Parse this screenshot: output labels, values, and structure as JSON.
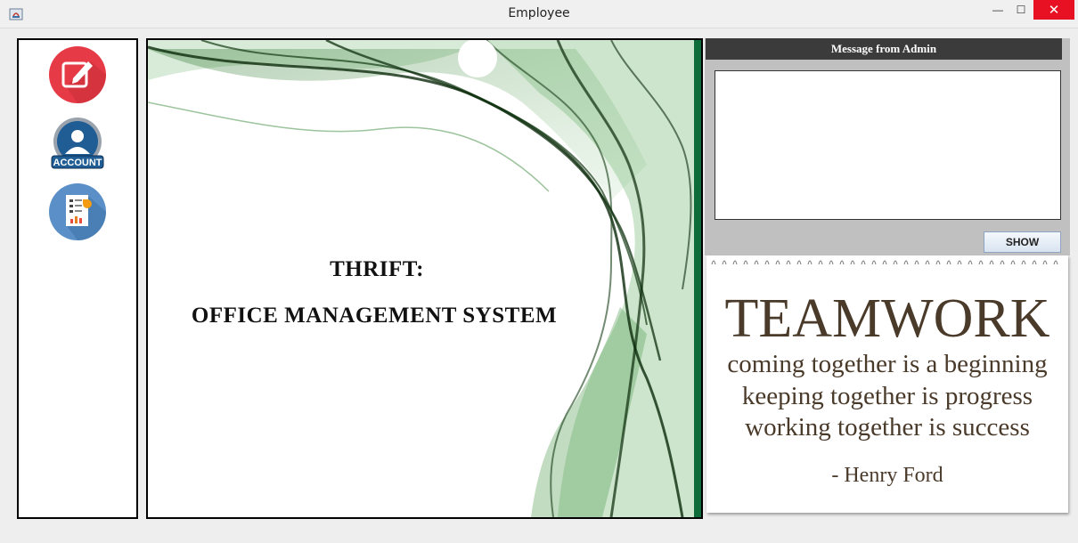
{
  "window": {
    "title": "Employee",
    "minimize_glyph": "—",
    "maximize_glyph": "☐",
    "close_glyph": "✕"
  },
  "sidebar": {
    "items": [
      {
        "name": "edit",
        "icon": "edit-icon",
        "color": "#e63a46"
      },
      {
        "name": "account",
        "icon": "account-icon",
        "label": "ACCOUNT",
        "color": "#2b6aa0"
      },
      {
        "name": "report",
        "icon": "report-icon",
        "color": "#5a8fc7"
      }
    ]
  },
  "main": {
    "title_line1": "THRIFT:",
    "title_line2": "OFFICE MANAGEMENT SYSTEM",
    "accent_color": "#0e6b3a"
  },
  "messages": {
    "header": "Message from Admin",
    "message_value": "",
    "show_button": "SHOW"
  },
  "quote": {
    "title": "TEAMWORK",
    "lines": [
      "coming together is a beginning",
      "keeping together is progress",
      "working together is success"
    ],
    "author": "- Henry Ford"
  }
}
